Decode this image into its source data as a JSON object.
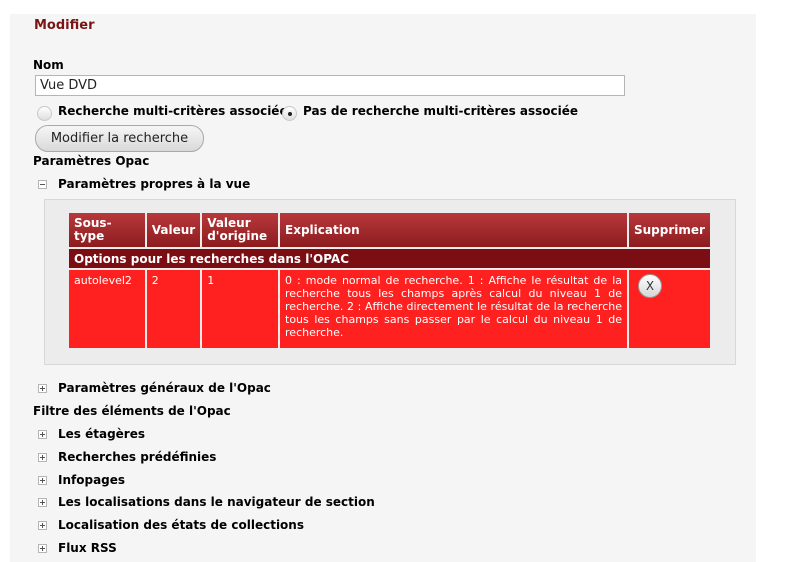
{
  "header": {
    "title": "Modifier"
  },
  "name_field": {
    "label": "Nom",
    "value": "Vue DVD"
  },
  "search_options": {
    "option1": "Recherche multi-critères associée",
    "option2": "Pas de recherche multi-critères associée",
    "selected": "option2"
  },
  "modify_search_button": "Modifier la recherche",
  "opac_params": {
    "label": "Paramètres Opac",
    "view_params_label": "Paramètres propres à la vue",
    "table": {
      "headers": [
        "Sous-type",
        "Valeur",
        "Valeur d'origine",
        "Explication",
        "Supprimer"
      ],
      "header_origine_line1": "Valeur",
      "header_origine_line2": "d'origine",
      "section_label": "Options pour les recherches dans l'OPAC",
      "rows": [
        {
          "subtype": "autolevel2",
          "value": "2",
          "origin_value": "1",
          "explanation": "0 : mode normal de recherche. 1 : Affiche le résultat de la recherche tous les champs après calcul du niveau 1 de recherche. 2 : Affiche directement le résultat de la recherche tous les champs sans passer par le calcul du niveau 1 de recherche.",
          "delete_label": "X"
        }
      ]
    },
    "general_params_label": "Paramètres généraux de l'Opac"
  },
  "filters": {
    "label": "Filtre des éléments de l'Opac",
    "items": [
      "Les étagères",
      "Recherches prédéfinies",
      "Infopages",
      "Les localisations dans le navigateur de section",
      "Localisation des états de collections",
      "Flux RSS"
    ]
  },
  "colors": {
    "header_red": "#9f2a2d",
    "section_dark_red": "#7a0e12",
    "row_red": "#ff2020",
    "title_color": "#7a1515"
  }
}
